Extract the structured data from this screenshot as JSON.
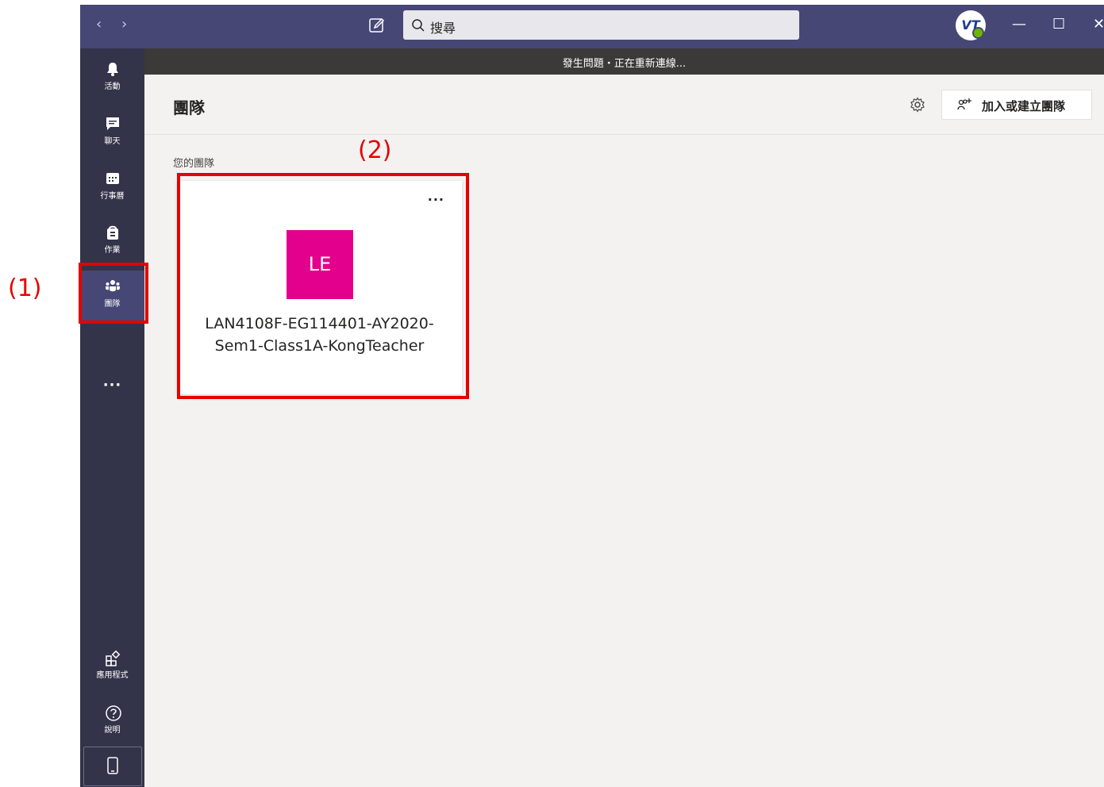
{
  "titlebar": {
    "back_glyph": "‹",
    "forward_glyph": "›",
    "search_placeholder": "搜尋",
    "profile_initials": "VT",
    "minimize_glyph": "—",
    "maximize_glyph": "☐",
    "close_glyph": "✕"
  },
  "rail": {
    "items": [
      {
        "label": "活動",
        "icon": "bell-icon"
      },
      {
        "label": "聊天",
        "icon": "chat-icon"
      },
      {
        "label": "行事曆",
        "icon": "calendar-icon"
      },
      {
        "label": "作業",
        "icon": "assignments-icon"
      },
      {
        "label": "團隊",
        "icon": "teams-icon",
        "active": true
      }
    ],
    "more_glyph": "···",
    "bottom_items": [
      {
        "label": "應用程式",
        "icon": "apps-icon"
      },
      {
        "label": "說明",
        "icon": "help-icon"
      }
    ]
  },
  "banner": {
    "text": "發生問題・正在重新連線..."
  },
  "main": {
    "title": "團隊",
    "join_label": "加入或建立團隊",
    "section_label": "您的團隊",
    "team": {
      "initials": "LE",
      "name_line1": "LAN4108F-EG114401-AY2020-",
      "name_line2": "Sem1-Class1A-KongTeacher",
      "more_glyph": "···",
      "color": "#e3008c"
    }
  },
  "annotations": {
    "label1": "(1)",
    "label2": "(2)",
    "color": "#e60000"
  },
  "colors": {
    "titlebar": "#464775",
    "rail": "#33344a",
    "rail_active": "#464775",
    "banner": "#3b3a39",
    "canvas": "#f3f2f1"
  }
}
